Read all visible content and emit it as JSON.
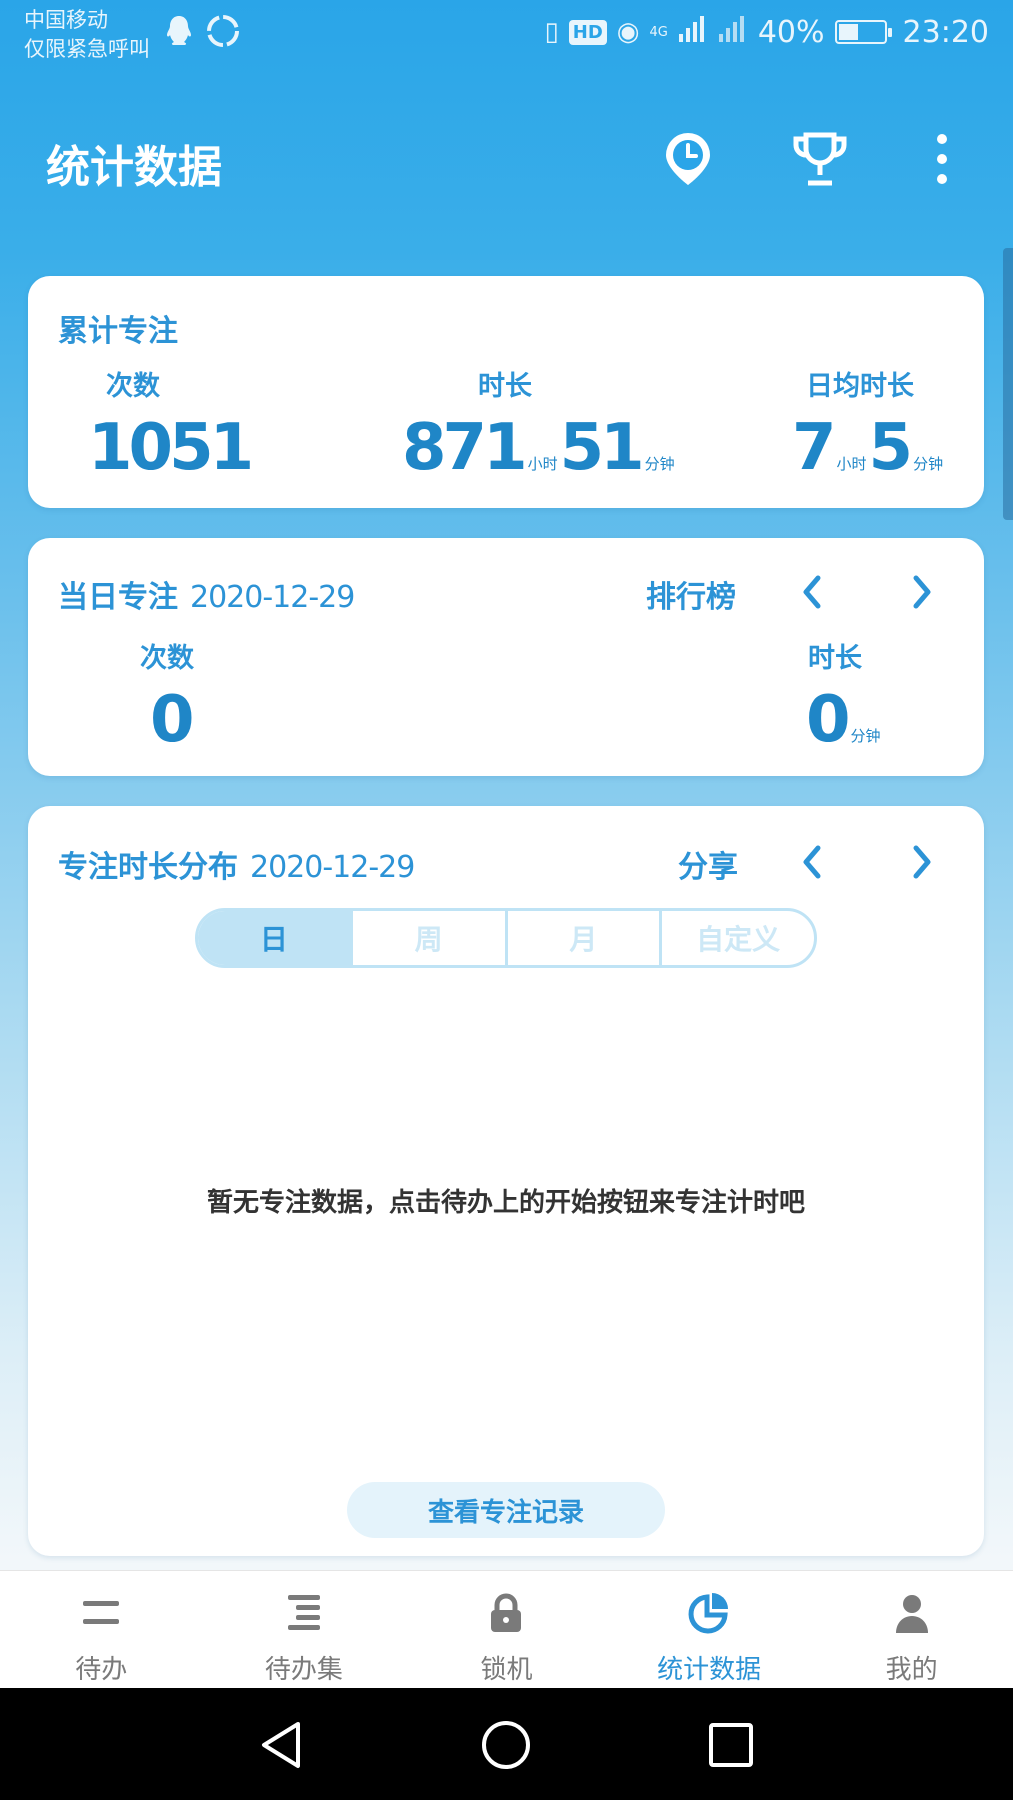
{
  "status_bar": {
    "carrier": "中国移动",
    "emergency": "仅限紧急呼叫",
    "network": "4G",
    "battery_percent": "40%",
    "time": "23:20"
  },
  "app_bar": {
    "title": "统计数据",
    "icons": [
      "timer-location-icon",
      "trophy-icon",
      "more-vert-icon"
    ]
  },
  "cumulative": {
    "title": "累计专注",
    "count_label": "次数",
    "count_value": "1051",
    "duration_label": "时长",
    "duration_hours": "871",
    "duration_minutes": "51",
    "avg_label": "日均时长",
    "avg_hours": "7",
    "avg_minutes": "5",
    "unit_hours": "小时",
    "unit_minutes": "分钟"
  },
  "daily": {
    "title": "当日专注",
    "date": "2020-12-29",
    "ranking": "排行榜",
    "count_label": "次数",
    "count_value": "0",
    "duration_label": "时长",
    "duration_value": "0",
    "unit_minutes": "分钟"
  },
  "distribution": {
    "title": "专注时长分布",
    "date": "2020-12-29",
    "share": "分享",
    "tabs": [
      {
        "label": "日",
        "active": true
      },
      {
        "label": "周",
        "active": false
      },
      {
        "label": "月",
        "active": false
      },
      {
        "label": "自定义",
        "active": false
      }
    ],
    "empty_message": "暂无专注数据，点击待办上的开始按钮来专注计时吧",
    "record_button": "查看专注记录"
  },
  "bottom_nav": [
    {
      "label": "待办",
      "icon": "list-icon",
      "active": false
    },
    {
      "label": "待办集",
      "icon": "list-set-icon",
      "active": false
    },
    {
      "label": "锁机",
      "icon": "lock-icon",
      "active": false
    },
    {
      "label": "统计数据",
      "icon": "pie-chart-icon",
      "active": true
    },
    {
      "label": "我的",
      "icon": "person-icon",
      "active": false
    }
  ],
  "colors": {
    "primary": "#2AA5E8",
    "accent_text": "#2C93D6",
    "nav_inactive": "#7A7A7A"
  }
}
